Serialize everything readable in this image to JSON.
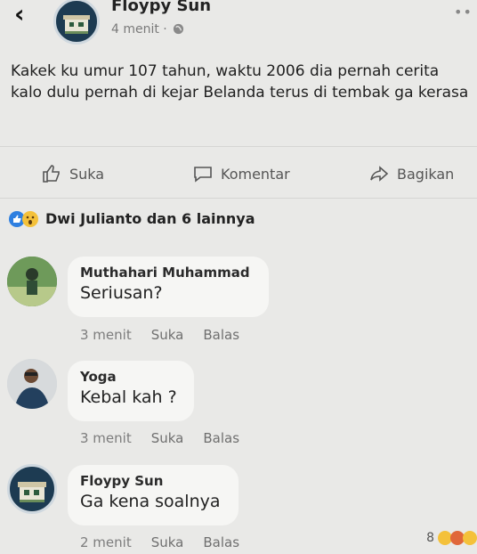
{
  "post": {
    "author": "Floypy Sun",
    "time": "4 menit ·",
    "text": "Kakek ku umur 107 tahun, waktu 2006 dia pernah cerita kalo dulu pernah di kejar Belanda terus di tembak ga kerasa"
  },
  "actions": {
    "like": "Suka",
    "comment": "Komentar",
    "share": "Bagikan"
  },
  "reactions_summary": "Dwi Julianto dan 6 lainnya",
  "comments": [
    {
      "name": "Muthahari Muhammad",
      "text": "Seriusan?",
      "time": "3 menit",
      "like": "Suka",
      "reply": "Balas"
    },
    {
      "name": "Yoga",
      "text": "Kebal kah ?",
      "time": "3 menit",
      "like": "Suka",
      "reply": "Balas"
    },
    {
      "name": "Floypy Sun",
      "text": "Ga kena soalnya",
      "time": "2 menit",
      "like": "Suka",
      "reply": "Balas"
    }
  ],
  "last_comment_reaction_count": "8",
  "colors": {
    "like_blue": "#2e7fe0",
    "wow_yellow": "#f4c13a",
    "haha_orange": "#e0673a"
  }
}
